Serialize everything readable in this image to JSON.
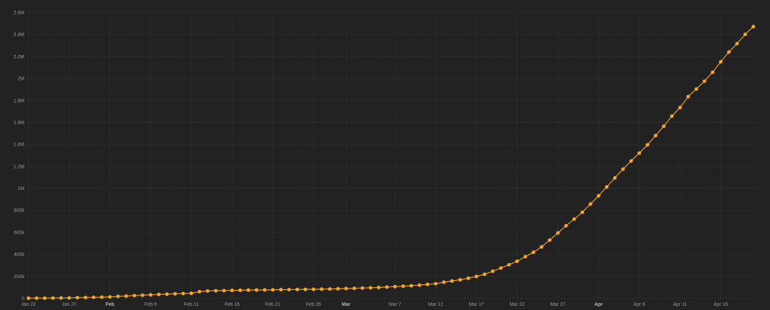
{
  "chart_data": {
    "type": "line",
    "title": "",
    "xlabel": "",
    "ylabel": "",
    "grid": true,
    "legend": "none",
    "colors": {
      "background": "#222222",
      "series": "#f6a623",
      "grid": "#343434",
      "tick_text": "#9a9a9a"
    },
    "x_range": [
      "2020-01-22",
      "2020-04-20"
    ],
    "ylim": [
      0,
      2600000
    ],
    "x_ticks": [
      {
        "date": "2020-01-22",
        "label": "Jan 22",
        "bold": false
      },
      {
        "date": "2020-01-27",
        "label": "Jan 27",
        "bold": false
      },
      {
        "date": "2020-02-01",
        "label": "Feb",
        "bold": true
      },
      {
        "date": "2020-02-06",
        "label": "Feb 6",
        "bold": false
      },
      {
        "date": "2020-02-11",
        "label": "Feb 11",
        "bold": false
      },
      {
        "date": "2020-02-16",
        "label": "Feb 16",
        "bold": false
      },
      {
        "date": "2020-02-21",
        "label": "Feb 21",
        "bold": false
      },
      {
        "date": "2020-02-26",
        "label": "Feb 26",
        "bold": false
      },
      {
        "date": "2020-03-01",
        "label": "Mar",
        "bold": true
      },
      {
        "date": "2020-03-07",
        "label": "Mar 7",
        "bold": false
      },
      {
        "date": "2020-03-12",
        "label": "Mar 12",
        "bold": false
      },
      {
        "date": "2020-03-17",
        "label": "Mar 17",
        "bold": false
      },
      {
        "date": "2020-03-22",
        "label": "Mar 22",
        "bold": false
      },
      {
        "date": "2020-03-27",
        "label": "Mar 27",
        "bold": false
      },
      {
        "date": "2020-04-01",
        "label": "Apr",
        "bold": true
      },
      {
        "date": "2020-04-06",
        "label": "Apr 6",
        "bold": false
      },
      {
        "date": "2020-04-11",
        "label": "Apr 11",
        "bold": false
      },
      {
        "date": "2020-04-16",
        "label": "Apr 16",
        "bold": false
      }
    ],
    "y_ticks": [
      {
        "value": 0,
        "label": "0"
      },
      {
        "value": 200000,
        "label": "200k"
      },
      {
        "value": 400000,
        "label": "400k"
      },
      {
        "value": 600000,
        "label": "600k"
      },
      {
        "value": 800000,
        "label": "800k"
      },
      {
        "value": 1000000,
        "label": "1M"
      },
      {
        "value": 1200000,
        "label": "1.2M"
      },
      {
        "value": 1400000,
        "label": "1.4M"
      },
      {
        "value": 1600000,
        "label": "1.6M"
      },
      {
        "value": 1800000,
        "label": "1.8M"
      },
      {
        "value": 2000000,
        "label": "2M"
      },
      {
        "value": 2200000,
        "label": "2.2M"
      },
      {
        "value": 2400000,
        "label": "2.4M"
      },
      {
        "value": 2600000,
        "label": "2.6M"
      }
    ],
    "series": [
      {
        "points": [
          [
            "2020-01-22",
            555
          ],
          [
            "2020-01-23",
            654
          ],
          [
            "2020-01-24",
            941
          ],
          [
            "2020-01-25",
            1434
          ],
          [
            "2020-01-26",
            2118
          ],
          [
            "2020-01-27",
            2927
          ],
          [
            "2020-01-28",
            5578
          ],
          [
            "2020-01-29",
            6166
          ],
          [
            "2020-01-30",
            8234
          ],
          [
            "2020-01-31",
            9927
          ],
          [
            "2020-02-01",
            12038
          ],
          [
            "2020-02-02",
            16787
          ],
          [
            "2020-02-03",
            19881
          ],
          [
            "2020-02-04",
            23892
          ],
          [
            "2020-02-05",
            27635
          ],
          [
            "2020-02-06",
            30794
          ],
          [
            "2020-02-07",
            34391
          ],
          [
            "2020-02-08",
            37120
          ],
          [
            "2020-02-09",
            40150
          ],
          [
            "2020-02-10",
            42762
          ],
          [
            "2020-02-11",
            44802
          ],
          [
            "2020-02-12",
            60000
          ],
          [
            "2020-02-13",
            66000
          ],
          [
            "2020-02-14",
            68000
          ],
          [
            "2020-02-15",
            69200
          ],
          [
            "2020-02-16",
            71000
          ],
          [
            "2020-02-17",
            72500
          ],
          [
            "2020-02-18",
            74000
          ],
          [
            "2020-02-19",
            75000
          ],
          [
            "2020-02-20",
            75700
          ],
          [
            "2020-02-21",
            76300
          ],
          [
            "2020-02-22",
            78000
          ],
          [
            "2020-02-23",
            78500
          ],
          [
            "2020-02-24",
            79500
          ],
          [
            "2020-02-25",
            80400
          ],
          [
            "2020-02-26",
            81400
          ],
          [
            "2020-02-27",
            82700
          ],
          [
            "2020-02-28",
            84100
          ],
          [
            "2020-02-29",
            86000
          ],
          [
            "2020-03-01",
            88400
          ],
          [
            "2020-03-02",
            90300
          ],
          [
            "2020-03-03",
            92800
          ],
          [
            "2020-03-04",
            95100
          ],
          [
            "2020-03-05",
            97900
          ],
          [
            "2020-03-06",
            101800
          ],
          [
            "2020-03-07",
            105800
          ],
          [
            "2020-03-08",
            109800
          ],
          [
            "2020-03-09",
            113600
          ],
          [
            "2020-03-10",
            119000
          ],
          [
            "2020-03-11",
            126000
          ],
          [
            "2020-03-12",
            132000
          ],
          [
            "2020-03-13",
            146000
          ],
          [
            "2020-03-14",
            157000
          ],
          [
            "2020-03-15",
            168000
          ],
          [
            "2020-03-16",
            182000
          ],
          [
            "2020-03-17",
            198000
          ],
          [
            "2020-03-18",
            218000
          ],
          [
            "2020-03-19",
            246000
          ],
          [
            "2020-03-20",
            275000
          ],
          [
            "2020-03-21",
            305000
          ],
          [
            "2020-03-22",
            337000
          ],
          [
            "2020-03-23",
            378000
          ],
          [
            "2020-03-24",
            418000
          ],
          [
            "2020-03-25",
            467000
          ],
          [
            "2020-03-26",
            529000
          ],
          [
            "2020-03-27",
            594000
          ],
          [
            "2020-03-28",
            660000
          ],
          [
            "2020-03-29",
            720000
          ],
          [
            "2020-03-30",
            782000
          ],
          [
            "2020-03-31",
            857000
          ],
          [
            "2020-04-01",
            932000
          ],
          [
            "2020-04-02",
            1013000
          ],
          [
            "2020-04-03",
            1095000
          ],
          [
            "2020-04-04",
            1175000
          ],
          [
            "2020-04-05",
            1249000
          ],
          [
            "2020-04-06",
            1321000
          ],
          [
            "2020-04-07",
            1396000
          ],
          [
            "2020-04-08",
            1480000
          ],
          [
            "2020-04-09",
            1565000
          ],
          [
            "2020-04-10",
            1657000
          ],
          [
            "2020-04-11",
            1735000
          ],
          [
            "2020-04-12",
            1834000
          ],
          [
            "2020-04-13",
            1904000
          ],
          [
            "2020-04-14",
            1975000
          ],
          [
            "2020-04-15",
            2056000
          ],
          [
            "2020-04-16",
            2152000
          ],
          [
            "2020-04-17",
            2240000
          ],
          [
            "2020-04-18",
            2317000
          ],
          [
            "2020-04-19",
            2401000
          ],
          [
            "2020-04-20",
            2472000
          ]
        ]
      }
    ]
  }
}
